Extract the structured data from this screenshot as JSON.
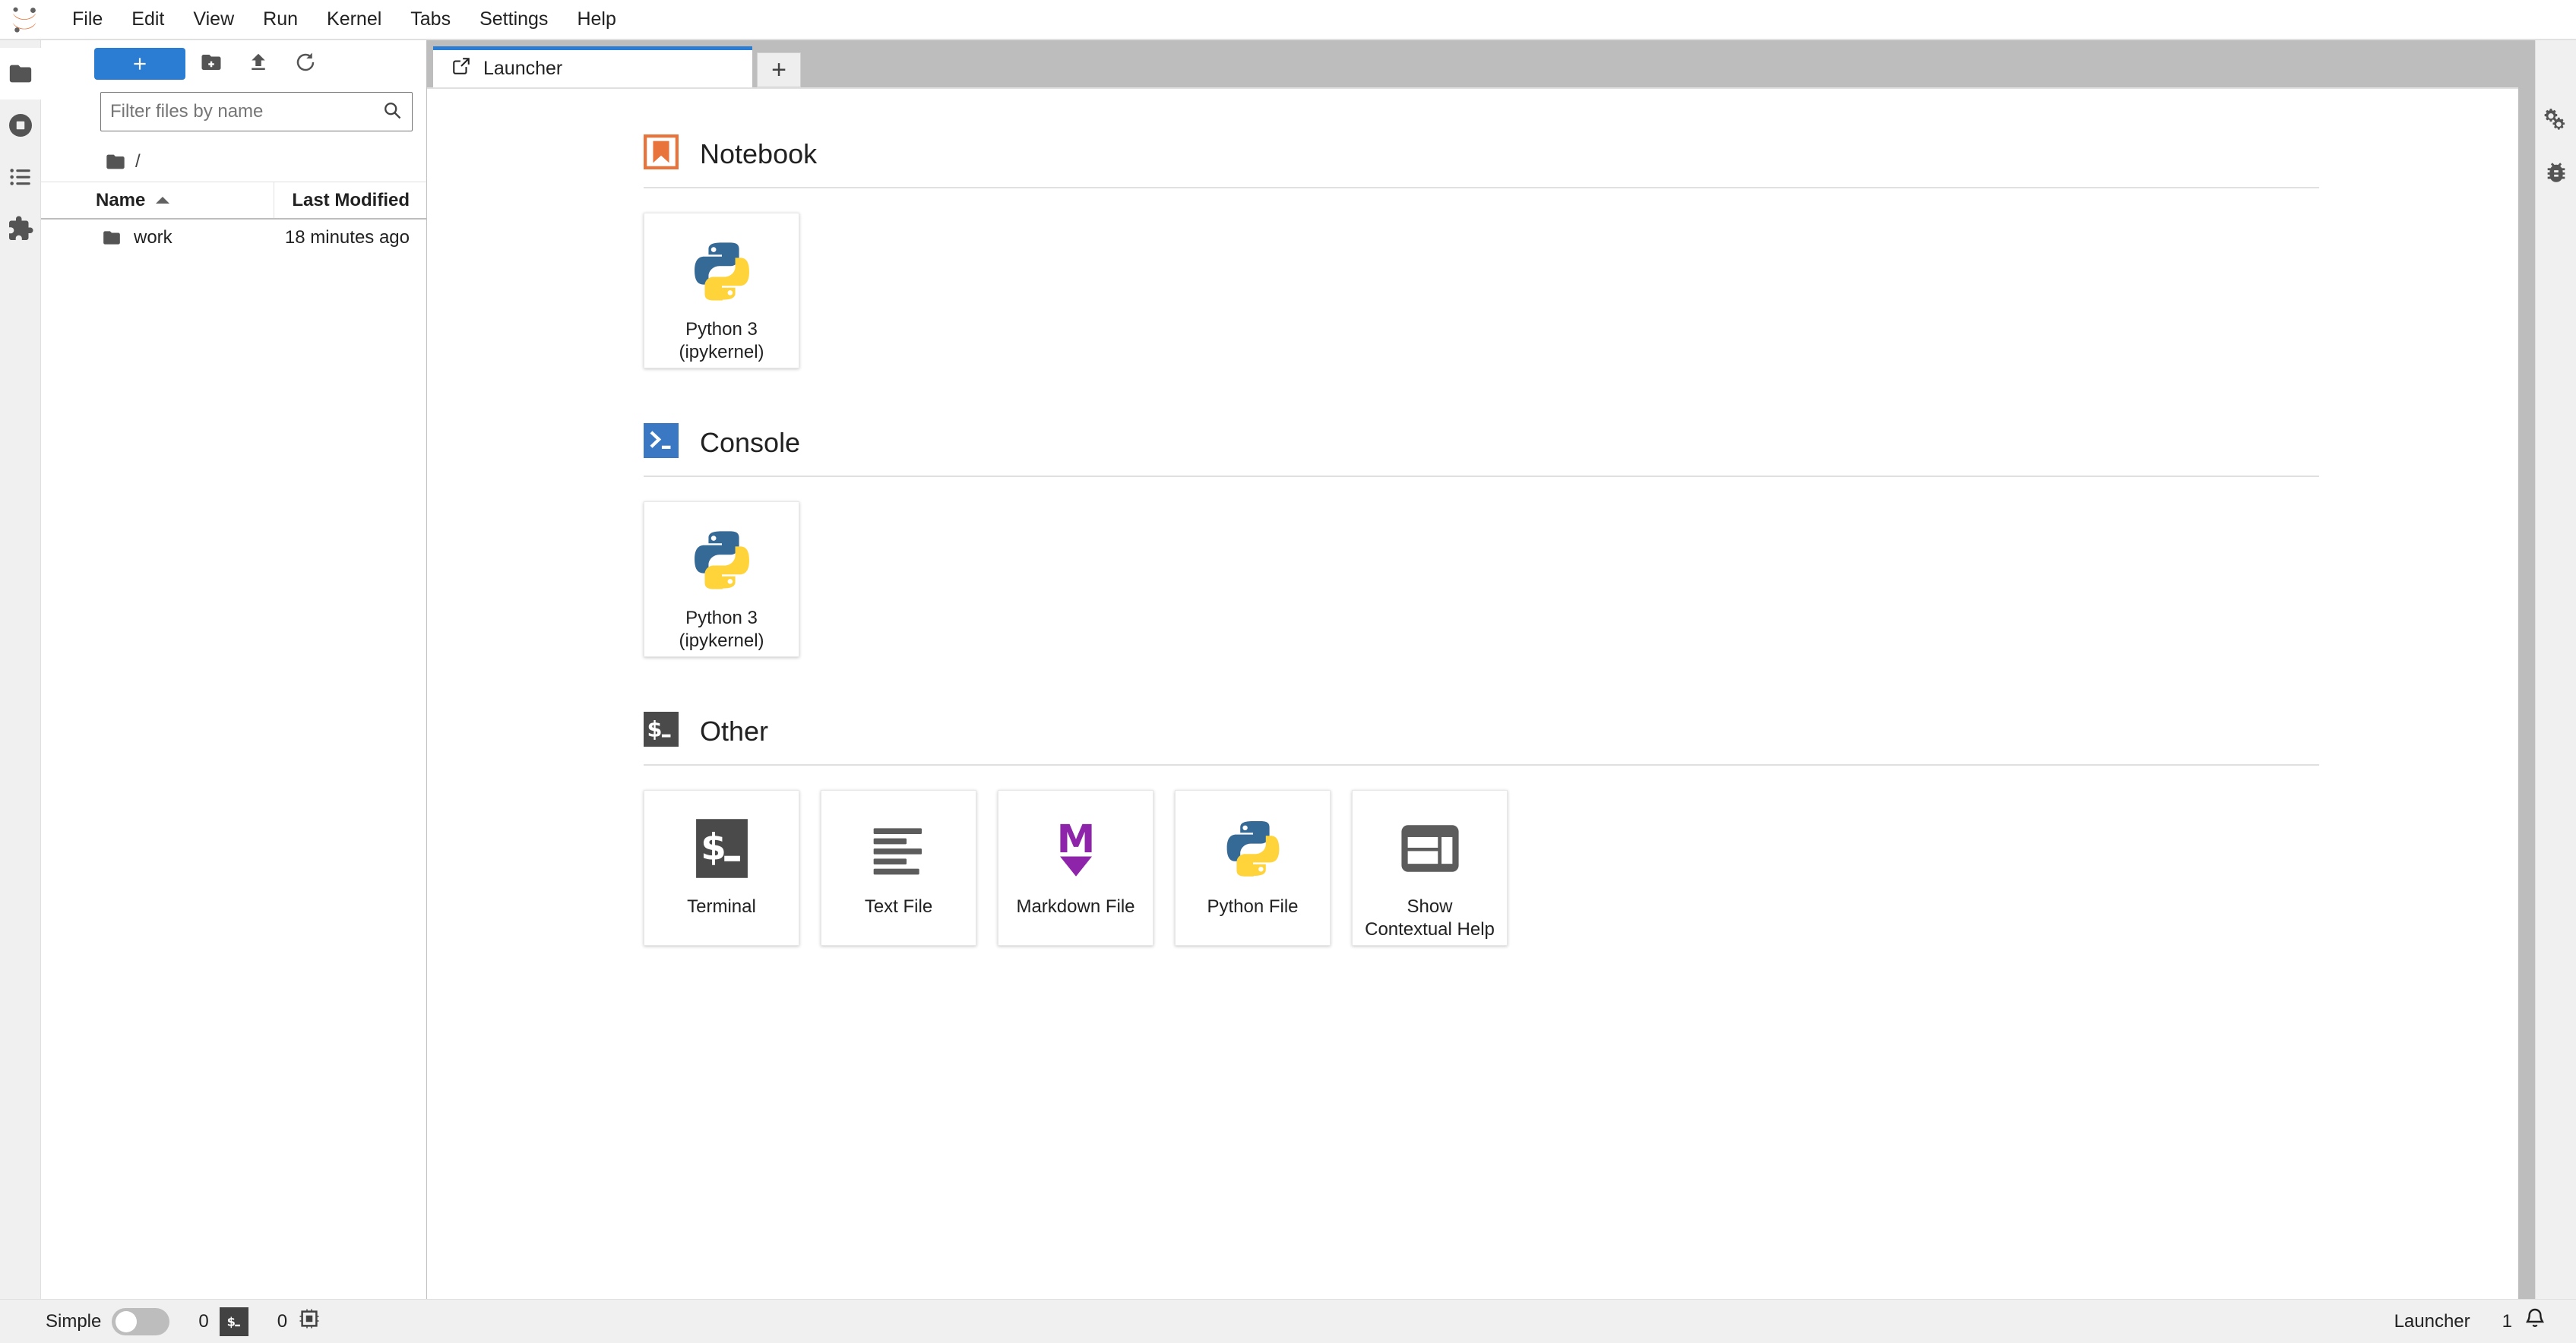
{
  "app": {
    "logo_icon": "jupyter-logo-icon"
  },
  "menubar": {
    "items": [
      {
        "label": "File",
        "name": "menu-file"
      },
      {
        "label": "Edit",
        "name": "menu-edit"
      },
      {
        "label": "View",
        "name": "menu-view"
      },
      {
        "label": "Run",
        "name": "menu-run"
      },
      {
        "label": "Kernel",
        "name": "menu-kernel"
      },
      {
        "label": "Tabs",
        "name": "menu-tabs"
      },
      {
        "label": "Settings",
        "name": "menu-settings"
      },
      {
        "label": "Help",
        "name": "menu-help"
      }
    ]
  },
  "activitybar_left": {
    "items": [
      {
        "name": "sidebar-item-file-browser",
        "icon": "folder-icon",
        "active": true
      },
      {
        "name": "sidebar-item-running-terminals-kernels",
        "icon": "stop-circle-icon",
        "active": false
      },
      {
        "name": "sidebar-item-table-of-contents",
        "icon": "list-icon",
        "active": false
      },
      {
        "name": "sidebar-item-extension-manager",
        "icon": "puzzle-piece-icon",
        "active": false
      }
    ]
  },
  "activitybar_right": {
    "items": [
      {
        "name": "sidebar-item-property-inspector",
        "icon": "gears-icon"
      },
      {
        "name": "sidebar-item-debugger",
        "icon": "bug-icon"
      }
    ]
  },
  "filebrowser": {
    "toolbar": {
      "new_launcher_label": "+",
      "new_launcher_name": "new-launcher-button",
      "new_folder_icon": "new-folder-icon",
      "upload_icon": "upload-icon",
      "refresh_icon": "refresh-icon"
    },
    "filter": {
      "placeholder": "Filter files by name",
      "value": "",
      "search_icon": "search-icon"
    },
    "breadcrumb": {
      "home_icon": "folder-icon",
      "path": "/"
    },
    "columns": {
      "name": "Name",
      "last_modified": "Last Modified"
    },
    "rows": [
      {
        "name": "work",
        "last_modified": "18 minutes ago",
        "icon": "folder-icon"
      }
    ]
  },
  "dock": {
    "tab": {
      "label": "Launcher",
      "icon": "launcher-icon"
    },
    "add_tab_label": "+"
  },
  "launcher": {
    "sections": [
      {
        "title": "Notebook",
        "icon": "notebook-bookmark-icon",
        "name": "launcher-section-notebook",
        "cards": [
          {
            "label": "Python 3\n(ipykernel)",
            "icon": "python-logo-icon",
            "name": "launcher-card-notebook-python3"
          }
        ]
      },
      {
        "title": "Console",
        "icon": "console-prompt-icon",
        "name": "launcher-section-console",
        "cards": [
          {
            "label": "Python 3\n(ipykernel)",
            "icon": "python-logo-icon",
            "name": "launcher-card-console-python3"
          }
        ]
      },
      {
        "title": "Other",
        "icon": "terminal-dollar-icon",
        "name": "launcher-section-other",
        "cards": [
          {
            "label": "Terminal",
            "icon": "terminal-dollar-icon",
            "name": "launcher-card-terminal"
          },
          {
            "label": "Text File",
            "icon": "text-file-icon",
            "name": "launcher-card-text-file"
          },
          {
            "label": "Markdown File",
            "icon": "markdown-icon",
            "name": "launcher-card-markdown-file"
          },
          {
            "label": "Python File",
            "icon": "python-logo-icon",
            "name": "launcher-card-python-file"
          },
          {
            "label": "Show\nContextual Help",
            "icon": "contextual-help-icon",
            "name": "launcher-card-contextual-help"
          }
        ]
      }
    ]
  },
  "statusbar": {
    "mode_label": "Simple",
    "mode_enabled": false,
    "kernel_count": "0",
    "terminal_count": "0",
    "terminal_icon": "terminal-dollar-icon",
    "kernel_icon": "cpu-chip-icon",
    "current_tab": "Launcher",
    "notification_count": "1",
    "notification_icon": "bell-icon"
  },
  "colors": {
    "accent": "#2b7cd3",
    "notebook_orange": "#e8743b",
    "console_blue": "#3b78c4",
    "terminal_dark": "#424242",
    "markdown_purple": "#8e24aa",
    "python_blue": "#366a96",
    "python_yellow": "#ffd43b"
  }
}
